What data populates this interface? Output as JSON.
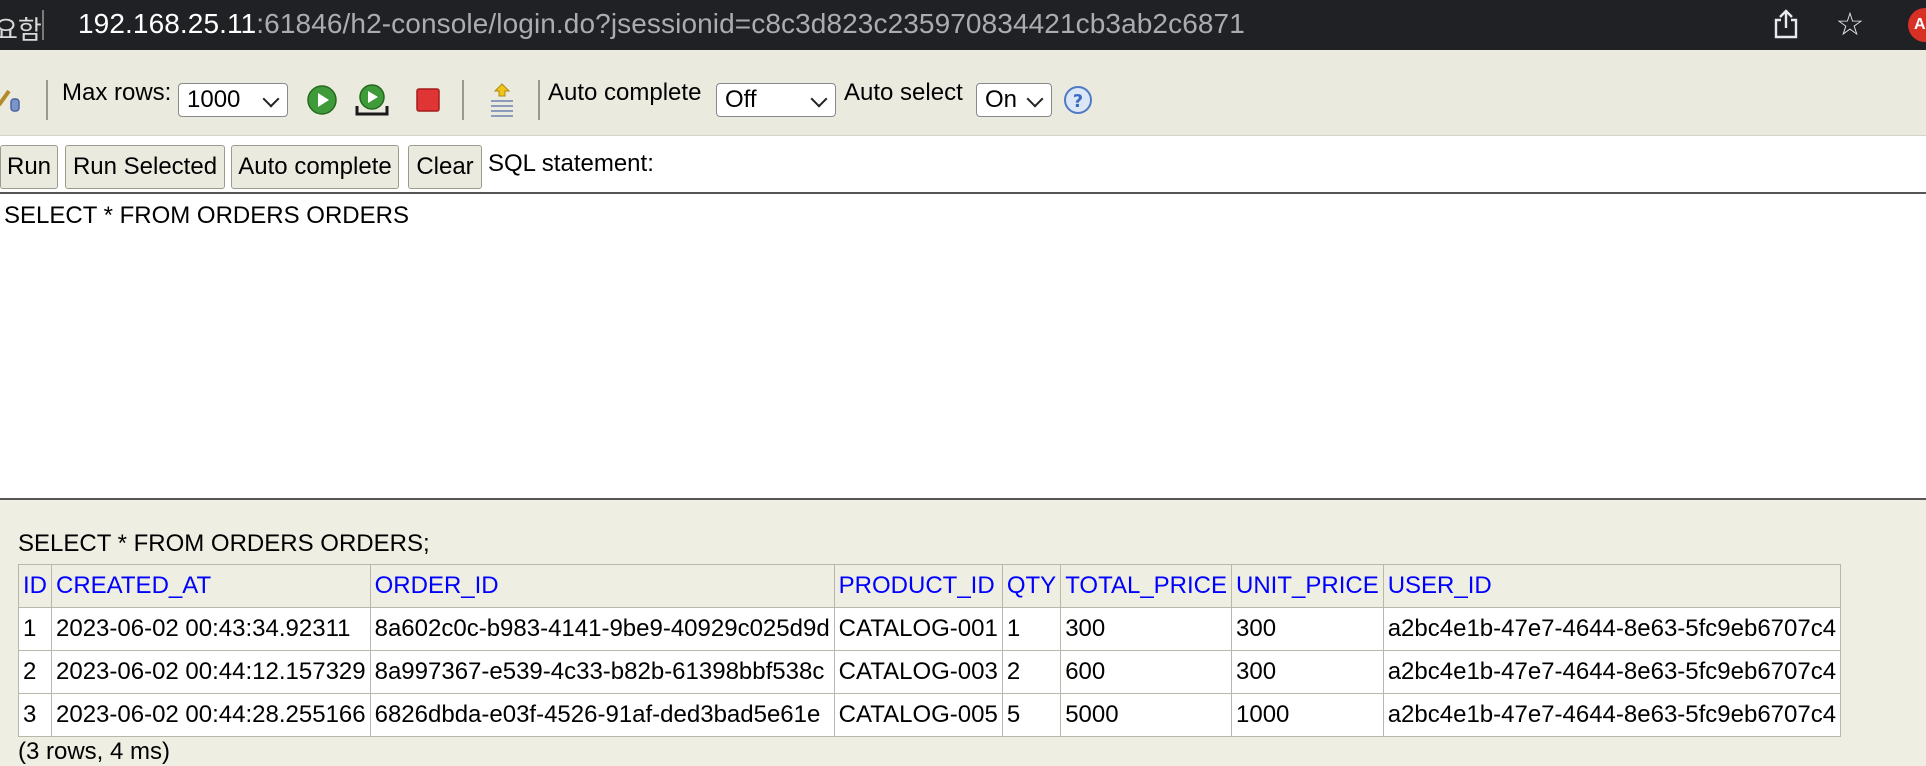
{
  "browser": {
    "site_info_text": "요함",
    "url_host": "192.168.25.11",
    "url_rest": ":61846/h2-console/login.do?jsessionid=c8c3d823c235970834421cb3ab2c6871",
    "extension_badge": "A",
    "colors": {
      "bar_bg": "#202124",
      "host": "#ffffff",
      "rest": "#a9acb0"
    }
  },
  "toolbar": {
    "max_rows_label": "Max rows:",
    "max_rows_value": "1000",
    "auto_complete_label": "Auto complete",
    "auto_complete_value": "Off",
    "auto_select_label": "Auto select",
    "auto_select_value": "On",
    "icons": [
      "disconnect-icon",
      "run-icon",
      "run-selected-icon",
      "stop-icon",
      "history-icon",
      "help-icon"
    ]
  },
  "buttons": {
    "run": "Run",
    "run_selected": "Run Selected",
    "auto_complete": "Auto complete",
    "clear": "Clear",
    "sql_label": "SQL statement:"
  },
  "editor": {
    "sql": "SELECT * FROM ORDERS ORDERS"
  },
  "result": {
    "statement": "SELECT * FROM ORDERS ORDERS;",
    "columns": [
      "ID",
      "CREATED_AT",
      "ORDER_ID",
      "PRODUCT_ID",
      "QTY",
      "TOTAL_PRICE",
      "UNIT_PRICE",
      "USER_ID"
    ],
    "rows": [
      [
        "1",
        "2023-06-02 00:43:34.92311",
        "8a602c0c-b983-4141-9be9-40929c025d9d",
        "CATALOG-001",
        "1",
        "300",
        "300",
        "a2bc4e1b-47e7-4644-8e63-5fc9eb6707c4"
      ],
      [
        "2",
        "2023-06-02 00:44:12.157329",
        "8a997367-e539-4c33-b82b-61398bbf538c",
        "CATALOG-003",
        "2",
        "600",
        "300",
        "a2bc4e1b-47e7-4644-8e63-5fc9eb6707c4"
      ],
      [
        "3",
        "2023-06-02 00:44:28.255166",
        "6826dbda-e03f-4526-91af-ded3bad5e61e",
        "CATALOG-005",
        "5",
        "5000",
        "1000",
        "a2bc4e1b-47e7-4644-8e63-5fc9eb6707c4"
      ]
    ],
    "footer": "(3 rows, 4 ms)",
    "colors": {
      "header_text": "#0000ff",
      "panel_bg": "#efeee2"
    }
  }
}
